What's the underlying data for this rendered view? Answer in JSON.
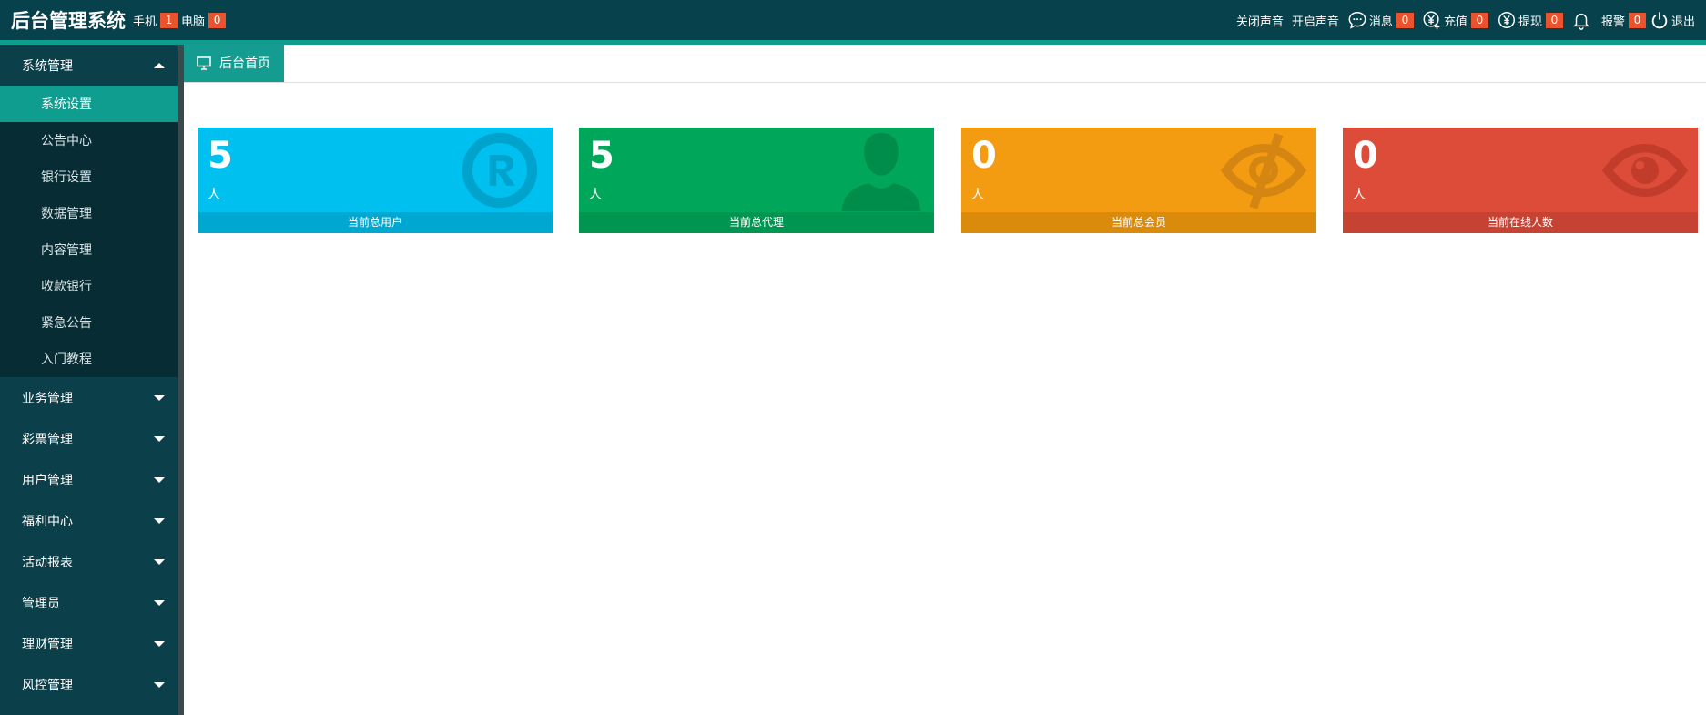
{
  "header": {
    "title": "后台管理系统",
    "devices": [
      {
        "label": "手机",
        "count": "1"
      },
      {
        "label": "电脑",
        "count": "0"
      }
    ],
    "actions": {
      "sound_off": "关闭声音",
      "sound_on": "开启声音",
      "messages": {
        "label": "消息",
        "count": "0"
      },
      "recharge": {
        "label": "充值",
        "count": "0"
      },
      "withdraw": {
        "label": "提现",
        "count": "0"
      },
      "alarm": {
        "label": "报警",
        "count": "0"
      },
      "logout": "退出"
    }
  },
  "sidebar": {
    "groups": [
      {
        "label": "系统管理",
        "expanded": true,
        "items": [
          "系统设置",
          "公告中心",
          "银行设置",
          "数据管理",
          "内容管理",
          "收款银行",
          "紧急公告",
          "入门教程"
        ],
        "active_index": 0
      },
      {
        "label": "业务管理"
      },
      {
        "label": "彩票管理"
      },
      {
        "label": "用户管理"
      },
      {
        "label": "福利中心"
      },
      {
        "label": "活动报表"
      },
      {
        "label": "管理员"
      },
      {
        "label": "理财管理"
      },
      {
        "label": "风控管理"
      }
    ]
  },
  "main": {
    "tab": {
      "label": "后台首页",
      "icon": "monitor-icon"
    },
    "cards": [
      {
        "value": "5",
        "unit": "人",
        "label": "当前总用户",
        "icon": "registered-icon",
        "color": "#00c0ef",
        "footer_color": "#00a7d0"
      },
      {
        "value": "5",
        "unit": "人",
        "label": "当前总代理",
        "icon": "user-icon",
        "color": "#00a65a",
        "footer_color": "#009551"
      },
      {
        "value": "0",
        "unit": "人",
        "label": "当前总会员",
        "icon": "eye-slash-icon",
        "color": "#f39c12",
        "footer_color": "#db8b0b"
      },
      {
        "value": "0",
        "unit": "人",
        "label": "当前在线人数",
        "icon": "eye-icon",
        "color": "#dd4b39",
        "footer_color": "#c64333"
      }
    ]
  }
}
